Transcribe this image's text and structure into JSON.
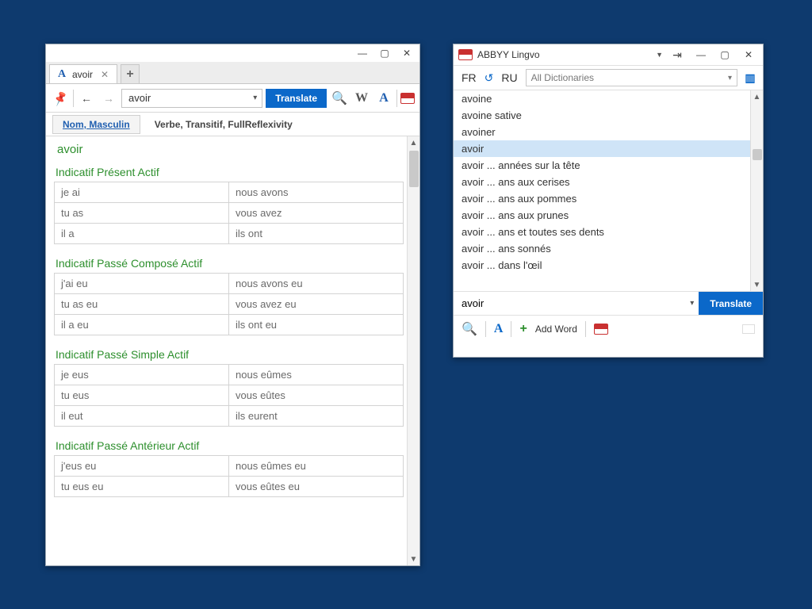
{
  "leftWindow": {
    "tabTitle": "avoir",
    "searchValue": "avoir",
    "translateLabel": "Translate",
    "grammarTabs": {
      "active": "Nom, Masculin",
      "other": "Verbe, Transitif, FullReflexivity"
    },
    "headword": "avoir",
    "tenses": [
      {
        "title": "Indicatif Présent Actif",
        "rows": [
          [
            "je ai",
            "nous avons"
          ],
          [
            "tu as",
            "vous avez"
          ],
          [
            "il a",
            "ils ont"
          ]
        ]
      },
      {
        "title": "Indicatif Passé Composé Actif",
        "rows": [
          [
            "j'ai eu",
            "nous avons eu"
          ],
          [
            "tu as eu",
            "vous avez eu"
          ],
          [
            "il a eu",
            "ils ont eu"
          ]
        ]
      },
      {
        "title": "Indicatif Passé Simple Actif",
        "rows": [
          [
            "je eus",
            "nous eûmes"
          ],
          [
            "tu eus",
            "vous eûtes"
          ],
          [
            "il eut",
            "ils eurent"
          ]
        ]
      },
      {
        "title": "Indicatif Passé Antérieur Actif",
        "rows": [
          [
            "j'eus eu",
            "nous eûmes eu"
          ],
          [
            "tu eus eu",
            "vous eûtes eu"
          ]
        ]
      }
    ]
  },
  "rightWindow": {
    "title": "ABBYY Lingvo",
    "langFrom": "FR",
    "langTo": "RU",
    "dictSelector": "All Dictionaries",
    "listItems": [
      "avoine",
      "avoine sative",
      "avoiner",
      "avoir",
      "avoir ... années sur la tête",
      "avoir ... ans aux cerises",
      "avoir ... ans aux pommes",
      "avoir ... ans aux prunes",
      "avoir ... ans et toutes ses dents",
      "avoir ... ans sonnés",
      "avoir ... dans l'œil"
    ],
    "selectedIndex": 3,
    "inputValue": "avoir",
    "translateLabel": "Translate",
    "addWordLabel": "Add Word"
  }
}
